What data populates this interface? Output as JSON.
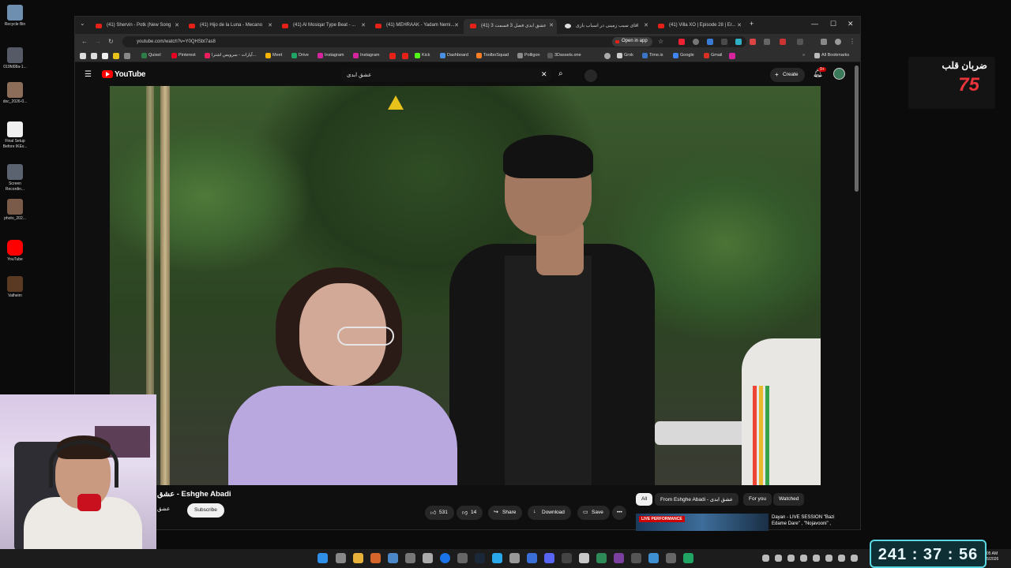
{
  "desktop": {
    "icons": [
      {
        "label": "Recycle Bin"
      },
      {
        "label": "019fd08a-1..."
      },
      {
        "label": "doc_2026-0..."
      },
      {
        "label": "Final Setup Before IKEv..."
      },
      {
        "label": "Screen Recordin..."
      },
      {
        "label": "photo_202..."
      },
      {
        "label": "YouTube"
      },
      {
        "label": "Valheim"
      }
    ]
  },
  "browser": {
    "tabs": [
      {
        "label": "(41) Shervin - Potk (New Song"
      },
      {
        "label": "(41) Hijo de la Luna - Mecano"
      },
      {
        "label": "(41) Al Mosiqar Type Beat - ..."
      },
      {
        "label": "(41) MEHRAAK - Yadam Nemi..."
      },
      {
        "label": "(41) عشق ابدی فصل 3 قسمت 3"
      },
      {
        "label": "اقای سیب زمینی در اسباب بازی"
      },
      {
        "label": "(41) Villa XO | Episode 28 | Er..."
      }
    ],
    "url": "youtube.com/watch?v=Y0QHSbt7as8",
    "open_in_app": "Open in app",
    "bookmarks": [
      {
        "label": "Quixel",
        "color": "#2d7d46"
      },
      {
        "label": "Pinterest",
        "color": "#e60023"
      },
      {
        "label": "آپارات - سرویس اشترا...",
        "color": "#ea1d5d"
      },
      {
        "label": "Meet",
        "color": "#f4b400"
      },
      {
        "label": "Drive",
        "color": "#1fa463"
      },
      {
        "label": "Instagram",
        "color": "#d6249f"
      },
      {
        "label": "Instagram",
        "color": "#d6249f"
      },
      {
        "label": "Kick",
        "color": "#53fc18"
      },
      {
        "label": "Dashboard",
        "color": "#4a90e2"
      },
      {
        "label": "ToolboSquad",
        "color": "#ff7f27"
      },
      {
        "label": "Polligon",
        "color": "#8c8c8c"
      },
      {
        "label": "3Dassets.one",
        "color": "#5a5a5a"
      },
      {
        "label": "Grok",
        "color": "#cccccc"
      },
      {
        "label": "Time.is",
        "color": "#3b74c4"
      },
      {
        "label": "Google",
        "color": "#4285f4"
      },
      {
        "label": "Gmail",
        "color": "#d93025"
      }
    ],
    "all_bookmarks": "All Bookmarks"
  },
  "youtube": {
    "logo": "YouTube",
    "search_value": "عشق ابدی",
    "create_label": "Create",
    "notif_badge": "9+",
    "video_title": "عشق - Eshghe Abadi",
    "channel_name": "عشق",
    "subscribe_label": "Subscribe",
    "likes": "531",
    "dislikes": "14",
    "share_label": "Share",
    "download_label": "Download",
    "save_label": "Save",
    "chips": [
      "All",
      "From Eshghe Abadi - عشق ابدی",
      "For you",
      "Watched"
    ],
    "recommended": {
      "badge": "LIVE PERFORMANCE",
      "title": "Dayan - LIVE SESSION \"Bazi Edame Dare\" , \"Nojavooni\" ,"
    }
  },
  "heart_rate": {
    "label": "ضربان قلب",
    "value": "75"
  },
  "timer": {
    "display": "241 : 37 : 56"
  },
  "taskbar": {
    "clock_time": "05 AM",
    "clock_date": "5/2026"
  },
  "colors": {
    "accent_red": "#ff0000",
    "hr_red": "#e8343a",
    "timer_border": "#59d7e3"
  }
}
